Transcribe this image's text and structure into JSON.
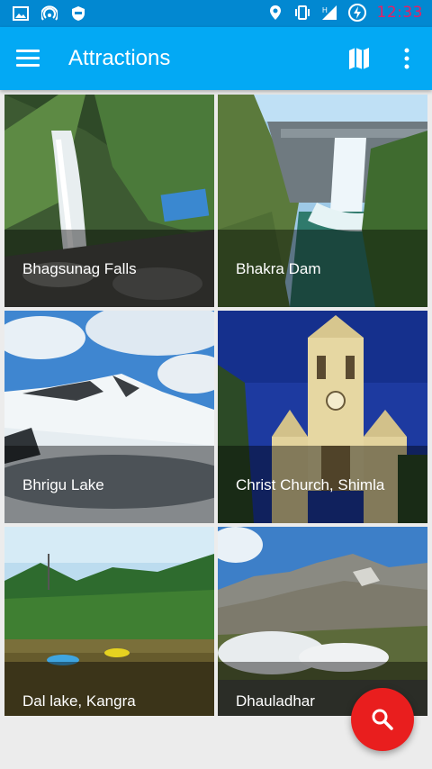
{
  "status_bar": {
    "time": "12:33",
    "icons": [
      "image-icon",
      "wifi-hotspot-icon",
      "shield-icon",
      "location-icon",
      "vibrate-icon",
      "signal-icon",
      "battery-charging-icon"
    ]
  },
  "app_bar": {
    "title": "Attractions",
    "left_icon": "menu-icon",
    "right_icons": [
      "map-icon",
      "more-vert-icon"
    ]
  },
  "attractions": [
    {
      "name": "Bhagsunag Falls"
    },
    {
      "name": "Bhakra Dam"
    },
    {
      "name": "Bhrigu Lake"
    },
    {
      "name": "Christ Church, Shimla"
    },
    {
      "name": "Dal lake, Kangra"
    },
    {
      "name": "Dhauladhar"
    }
  ],
  "fab": {
    "icon": "search-icon"
  },
  "colors": {
    "status_bar": "#0288d1",
    "app_bar": "#03a9f4",
    "fab": "#e91e1e",
    "clock": "#e91e63"
  }
}
